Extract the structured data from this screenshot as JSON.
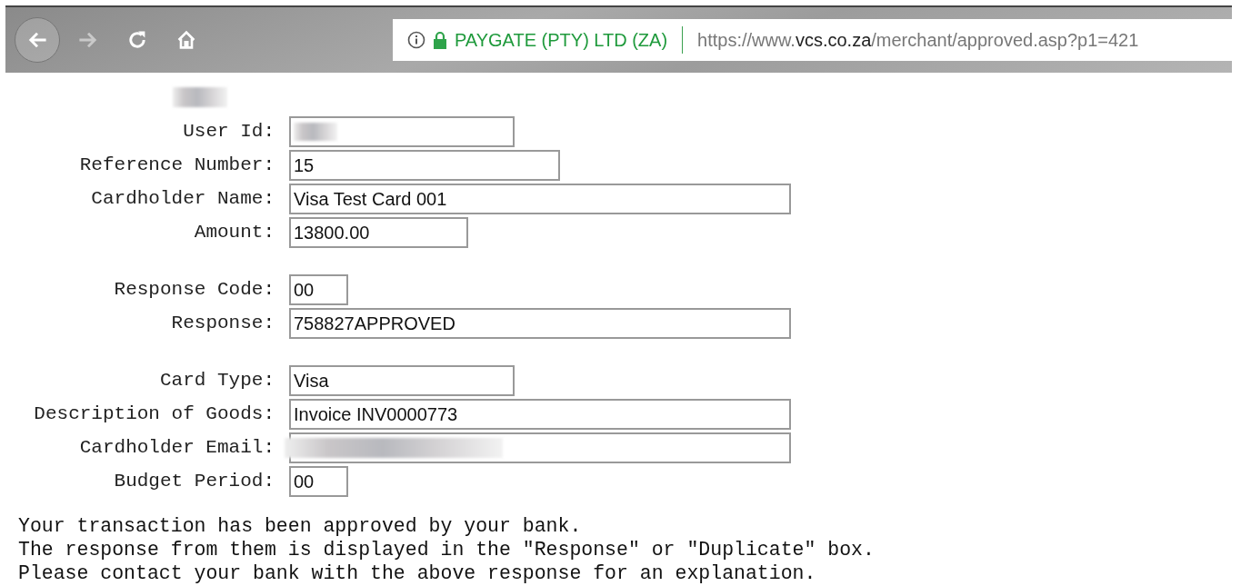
{
  "browser": {
    "nav": [
      {
        "kind": "back",
        "disabled": false
      },
      {
        "kind": "forward",
        "disabled": true
      },
      {
        "kind": "reload",
        "disabled": false
      },
      {
        "kind": "home",
        "disabled": false
      }
    ],
    "address_bar": {
      "site_identity": "PAYGATE (PTY) LTD (ZA)",
      "url_prefix": "https://www.",
      "url_host": "vcs.co.za",
      "url_path": "/merchant/approved.asp?p1=421"
    }
  },
  "page": {
    "header_redacted": true,
    "groups": [
      {
        "fields": [
          {
            "label": "User Id:",
            "redacted": true
          },
          {
            "label": "Reference Number:",
            "value": "15"
          },
          {
            "label": "Cardholder Name:",
            "value": "Visa Test Card 001"
          },
          {
            "label": "Amount:",
            "value": "13800.00"
          }
        ]
      },
      {
        "fields": [
          {
            "label": "Response Code:",
            "value": "00"
          },
          {
            "label": "Response:",
            "value": "758827APPROVED"
          }
        ]
      },
      {
        "fields": [
          {
            "label": "Card Type:",
            "value": "Visa"
          },
          {
            "label": "Description of Goods:",
            "value": "Invoice INV0000773"
          },
          {
            "label": "Cardholder Email:",
            "redacted": true
          },
          {
            "label": "Budget Period:",
            "value": "00"
          }
        ]
      }
    ],
    "message": [
      "Your transaction has been approved by your bank.",
      "The response from them is displayed in the \"Response\" or \"Duplicate\" box.",
      "Please contact your bank with the above response for an explanation."
    ]
  }
}
